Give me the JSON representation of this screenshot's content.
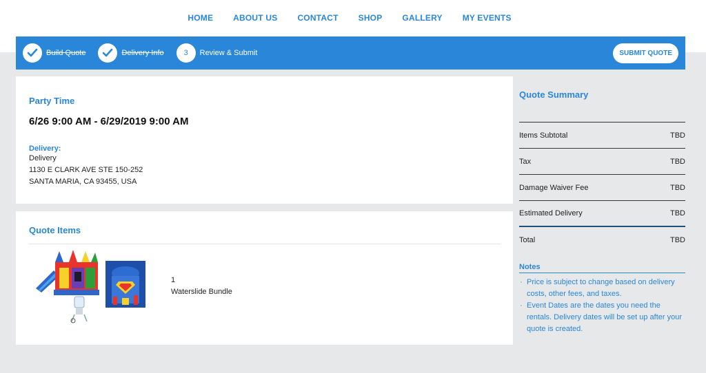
{
  "nav": {
    "items": [
      {
        "label": "HOME"
      },
      {
        "label": "ABOUT US"
      },
      {
        "label": "CONTACT"
      },
      {
        "label": "SHOP"
      },
      {
        "label": "GALLERY"
      },
      {
        "label": "MY EVENTS"
      }
    ]
  },
  "steps": [
    {
      "number": "",
      "label": "Build Quote",
      "done": true
    },
    {
      "number": "",
      "label": "Delivery Info",
      "done": true
    },
    {
      "number": "3",
      "label": "Review & Submit",
      "done": false
    }
  ],
  "submit_label": "SUBMIT QUOTE",
  "party": {
    "title": "Party Time",
    "dates": "6/26 9:00 AM - 6/29/2019 9:00 AM",
    "delivery_label": "Delivery:",
    "delivery_method": "Delivery",
    "address_line1": "1130 E CLARK AVE STE 150-252",
    "address_line2": "SANTA MARIA, CA 93455, USA"
  },
  "quote_items": {
    "title": "Quote Items",
    "items": [
      {
        "quantity": "1",
        "name": "Waterslide Bundle"
      }
    ]
  },
  "summary": {
    "title": "Quote Summary",
    "rows": [
      {
        "label": "Items Subtotal",
        "value": "TBD"
      },
      {
        "label": "Tax",
        "value": "TBD"
      },
      {
        "label": "Damage Waiver Fee",
        "value": "TBD"
      },
      {
        "label": "Estimated Delivery",
        "value": "TBD"
      },
      {
        "label": "Total",
        "value": "TBD"
      }
    ],
    "notes_label": "Notes",
    "notes": [
      "Price is subject to change based on delivery costs, other fees, and taxes.",
      "Event Dates are the dates you need the rentals. Delivery dates will be set up after your quote is created."
    ]
  },
  "colors": {
    "accent": "#2a86d8",
    "background": "#e6e8ea"
  }
}
